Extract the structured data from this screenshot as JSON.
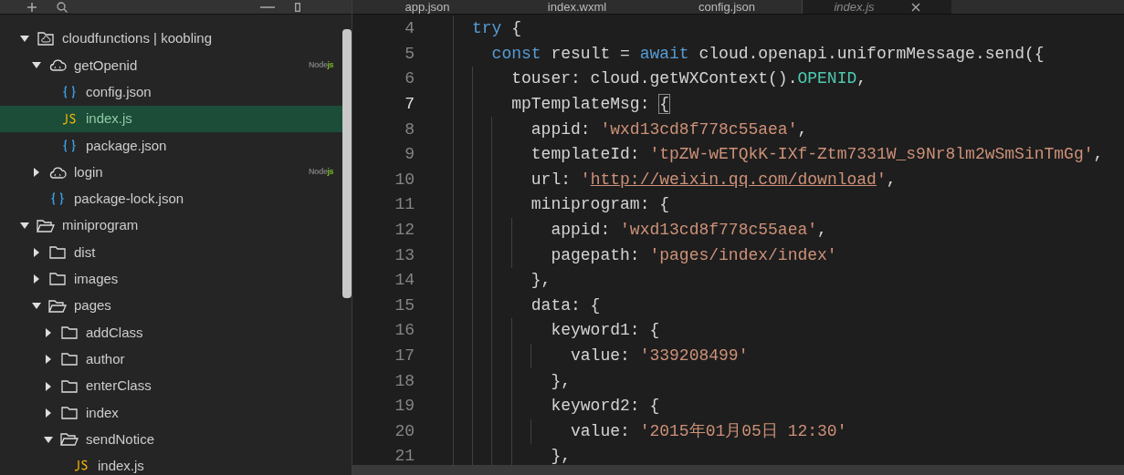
{
  "tabs": [
    {
      "label": "app.json",
      "selected": false
    },
    {
      "label": "index.wxml",
      "selected": false
    },
    {
      "label": "config.json",
      "selected": false
    },
    {
      "label": "index.js",
      "selected": true
    }
  ],
  "tree": [
    {
      "label": "cloudfunctions | koobling",
      "kind": "cloud-root",
      "expanded": true,
      "selected": false,
      "children": [
        {
          "label": "getOpenid",
          "kind": "cloud",
          "expanded": true,
          "selected": false,
          "badge": [
            "Node",
            "js"
          ],
          "children": [
            {
              "label": "config.json",
              "kind": "json",
              "selected": false
            },
            {
              "label": "index.js",
              "kind": "js",
              "selected": true
            },
            {
              "label": "package.json",
              "kind": "json",
              "selected": false
            }
          ]
        },
        {
          "label": "login",
          "kind": "cloud",
          "expanded": false,
          "selected": false,
          "badge": [
            "Node",
            "js"
          ]
        },
        {
          "label": "package-lock.json",
          "kind": "json",
          "selected": false
        }
      ]
    },
    {
      "label": "miniprogram",
      "kind": "folder",
      "expanded": true,
      "selected": false,
      "children": [
        {
          "label": "dist",
          "kind": "folder",
          "expanded": false,
          "selected": false
        },
        {
          "label": "images",
          "kind": "folder",
          "expanded": false,
          "selected": false
        },
        {
          "label": "pages",
          "kind": "folder",
          "expanded": true,
          "selected": false,
          "children": [
            {
              "label": "addClass",
              "kind": "folder",
              "expanded": false,
              "selected": false
            },
            {
              "label": "author",
              "kind": "folder",
              "expanded": false,
              "selected": false
            },
            {
              "label": "enterClass",
              "kind": "folder",
              "expanded": false,
              "selected": false
            },
            {
              "label": "index",
              "kind": "folder",
              "expanded": false,
              "selected": false
            },
            {
              "label": "sendNotice",
              "kind": "folder",
              "expanded": true,
              "selected": false,
              "children": [
                {
                  "label": "index.js",
                  "kind": "js",
                  "selected": false
                }
              ]
            }
          ]
        }
      ]
    }
  ],
  "code": [
    {
      "number": "4",
      "tokens": [
        {
          "t": "try",
          "kind": "keyword"
        },
        {
          "t": " {",
          "kind": "plain"
        }
      ]
    },
    {
      "number": "5",
      "tokens": [
        {
          "t": "  const",
          "kind": "keyword"
        },
        {
          "t": " result = ",
          "kind": "plain"
        },
        {
          "t": "await",
          "kind": "keyword"
        },
        {
          "t": " cloud.openapi.uniformMessage.send({",
          "kind": "plain"
        }
      ]
    },
    {
      "number": "6",
      "tokens": [
        {
          "t": "    touser: cloud.getWXContext().",
          "kind": "plain"
        },
        {
          "t": "OPENID",
          "kind": "constant"
        },
        {
          "t": ",",
          "kind": "plain"
        }
      ]
    },
    {
      "number": "7",
      "current": true,
      "tokens": [
        {
          "t": "    mpTemplateMsg: ",
          "kind": "plain"
        },
        {
          "t": "{",
          "kind": "bracket-match"
        }
      ]
    },
    {
      "number": "8",
      "tokens": [
        {
          "t": "      appid: ",
          "kind": "plain"
        },
        {
          "t": "'wxd13cd8f778c55aea'",
          "kind": "string"
        },
        {
          "t": ",",
          "kind": "plain"
        }
      ]
    },
    {
      "number": "9",
      "tokens": [
        {
          "t": "      templateId: ",
          "kind": "plain"
        },
        {
          "t": "'tpZW-wETQkK-IXf-Ztm7331W_s9Nr8lm2wSmSinTmGg'",
          "kind": "string"
        },
        {
          "t": ",",
          "kind": "plain"
        }
      ]
    },
    {
      "number": "10",
      "tokens": [
        {
          "t": "      url: ",
          "kind": "plain"
        },
        {
          "t": "'",
          "kind": "string"
        },
        {
          "t": "http://weixin.qq.com/download",
          "kind": "link"
        },
        {
          "t": "'",
          "kind": "string"
        },
        {
          "t": ",",
          "kind": "plain"
        }
      ]
    },
    {
      "number": "11",
      "tokens": [
        {
          "t": "      miniprogram: {",
          "kind": "plain"
        }
      ]
    },
    {
      "number": "12",
      "tokens": [
        {
          "t": "        appid: ",
          "kind": "plain"
        },
        {
          "t": "'wxd13cd8f778c55aea'",
          "kind": "string"
        },
        {
          "t": ",",
          "kind": "plain"
        }
      ]
    },
    {
      "number": "13",
      "tokens": [
        {
          "t": "        pagepath: ",
          "kind": "plain"
        },
        {
          "t": "'pages/index/index'",
          "kind": "string"
        }
      ]
    },
    {
      "number": "14",
      "tokens": [
        {
          "t": "      },",
          "kind": "plain"
        }
      ]
    },
    {
      "number": "15",
      "tokens": [
        {
          "t": "      data: {",
          "kind": "plain"
        }
      ]
    },
    {
      "number": "16",
      "tokens": [
        {
          "t": "        keyword1: {",
          "kind": "plain"
        }
      ]
    },
    {
      "number": "17",
      "tokens": [
        {
          "t": "          value: ",
          "kind": "plain"
        },
        {
          "t": "'339208499'",
          "kind": "string"
        }
      ]
    },
    {
      "number": "18",
      "tokens": [
        {
          "t": "        },",
          "kind": "plain"
        }
      ]
    },
    {
      "number": "19",
      "tokens": [
        {
          "t": "        keyword2: {",
          "kind": "plain"
        }
      ]
    },
    {
      "number": "20",
      "tokens": [
        {
          "t": "          value: ",
          "kind": "plain"
        },
        {
          "t": "'2015年01月05日 12:30'",
          "kind": "string"
        }
      ]
    },
    {
      "number": "21",
      "tokens": [
        {
          "t": "        },",
          "kind": "plain"
        }
      ]
    }
  ]
}
